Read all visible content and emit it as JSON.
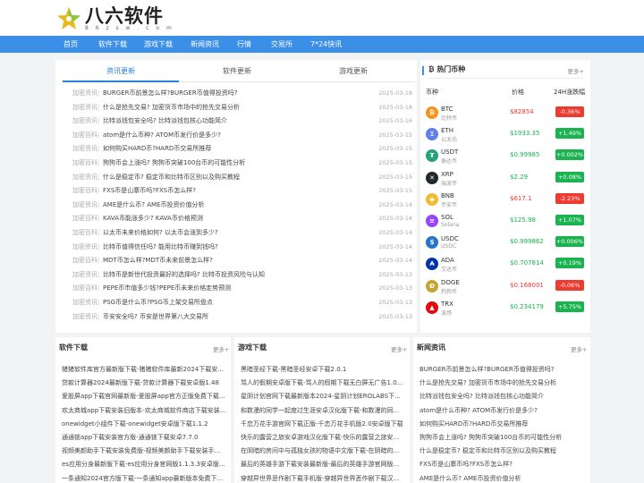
{
  "site": {
    "name": "八六软件",
    "domain": "8 6 z s w . c o m"
  },
  "nav": [
    "首页",
    "软件下载",
    "游戏下载",
    "新闻资讯",
    "行情",
    "交易所",
    "7*24快讯"
  ],
  "tabs": [
    "资讯更新",
    "软件更新",
    "游戏更新"
  ],
  "news": [
    {
      "cat": "加密资讯",
      "title": "BURGER币前景怎么样?BURGER币值得投资吗?",
      "date": "2025-03-18"
    },
    {
      "cat": "加密资讯",
      "title": "什么是抢先交易? 加密货币市场中的抢先交易分析",
      "date": "2025-03-18"
    },
    {
      "cat": "加密资讯",
      "title": "比特派钱包安全吗? 比特派钱包核心功能简介",
      "date": "2025-03-16"
    },
    {
      "cat": "加密百科",
      "title": "atom是什么币种? ATOM币发行价是多少?",
      "date": "2025-03-15"
    },
    {
      "cat": "加密资讯",
      "title": "如何购买HARD币?HARD币交易所推荐",
      "date": "2025-03-15"
    },
    {
      "cat": "加密百科",
      "title": "狗狗币会上涨吗? 狗狗币突破100台币的可能性分析",
      "date": "2025-03-15"
    },
    {
      "cat": "加密资讯",
      "title": "什么是稳定币? 稳定币和比特币区别以及购买教程",
      "date": "2025-03-15"
    },
    {
      "cat": "加密百科",
      "title": "FXS币是山寨币吗?FXS币怎么样?",
      "date": "2025-03-15"
    },
    {
      "cat": "加密资讯",
      "title": "AME是什么币? AME币投资价值分析",
      "date": "2025-03-14"
    },
    {
      "cat": "加密百科",
      "title": "KAVA币能涨多少? KAVA币价格预测",
      "date": "2025-03-14"
    },
    {
      "cat": "加密百科",
      "title": "以太币未来价格如何? 以太币会涨到多少?",
      "date": "2025-03-14"
    },
    {
      "cat": "加密资讯",
      "title": "比特币值得信任吗? 能用比特币赚到钱吗?",
      "date": "2025-03-14"
    },
    {
      "cat": "加密百科",
      "title": "MDT币怎么样?MDT币未来前景怎么样?",
      "date": "2025-03-14"
    },
    {
      "cat": "加密资讯",
      "title": "比特币是新世代投资最好的选择吗? 比特币投资风险与认知",
      "date": "2025-03-13"
    },
    {
      "cat": "加密百科",
      "title": "PEPE币市值多少钱?PEPE币未来价格走势预测",
      "date": "2025-03-13"
    },
    {
      "cat": "加密资讯",
      "title": "PSG币是什么币?PSG币上架交易所盘点",
      "date": "2025-03-13"
    },
    {
      "cat": "加密资讯",
      "title": "币安安全吗? 币安是世界第八大交易所",
      "date": "2025-03-13"
    }
  ],
  "coins": {
    "title": "热门币种",
    "more": "更多+",
    "headers": [
      "币种",
      "价格",
      "24H涨跌幅"
    ],
    "rows": [
      {
        "sym": "BTC",
        "cn": "比特币",
        "price": "$82854",
        "chg": "-0.36%",
        "icon_color": "#f7931a",
        "glyph": "₿"
      },
      {
        "sym": "ETH",
        "cn": "以太坊",
        "price": "$1933.35",
        "chg": "+1.49%",
        "icon_color": "#627eea",
        "glyph": "Ξ"
      },
      {
        "sym": "USDT",
        "cn": "泰达币",
        "price": "$0.99985",
        "chg": "+0.002%",
        "icon_color": "#26a17b",
        "glyph": "₮"
      },
      {
        "sym": "XRP",
        "cn": "瑞波币",
        "price": "$2.29",
        "chg": "+0.08%",
        "icon_color": "#23292f",
        "glyph": "✕"
      },
      {
        "sym": "BNB",
        "cn": "币安币",
        "price": "$617.1",
        "chg": "-2.23%",
        "icon_color": "#f3ba2f",
        "glyph": "◆"
      },
      {
        "sym": "SOL",
        "cn": "Solana",
        "price": "$125.98",
        "chg": "+1.07%",
        "icon_color": "#9945ff",
        "glyph": "≡"
      },
      {
        "sym": "USDC",
        "cn": "USDC",
        "price": "$0.999862",
        "chg": "+0.006%",
        "icon_color": "#2775ca",
        "glyph": "$"
      },
      {
        "sym": "ADA",
        "cn": "艾达币",
        "price": "$0.707814",
        "chg": "+0.19%",
        "icon_color": "#0033ad",
        "glyph": "₳"
      },
      {
        "sym": "DOGE",
        "cn": "狗狗币",
        "price": "$0.168001",
        "chg": "-0.06%",
        "icon_color": "#c2a633",
        "glyph": "Ð"
      },
      {
        "sym": "TRX",
        "cn": "波场",
        "price": "$0.234179",
        "chg": "+5.75%",
        "icon_color": "#e50915",
        "glyph": "▲"
      }
    ]
  },
  "colors": {
    "up": "#1ab34f",
    "down": "#ee3a2f",
    "brand": "#3b8fe6"
  },
  "sections": [
    {
      "title": "软件下载",
      "more": "更多+",
      "items": [
        "猪猪软件库官方最新版下载-猪猪软件库最新2024下载安...",
        "贷款计算器2024最新版下载-贷款计算器下载安卓版1.48",
        "爱股屏app下载官网最新版-爱股屏app官方正版免费下载...",
        "欢太商城app下载安装旧版本-欢太商城软件商店下载安装...",
        "onewidget小组件下载-onewidget安卓版下载1.1.2",
        "通通锁app下载安装官方版-通通锁下载安卓7.7.0",
        "视频美颜助手下载安装免费版-视频美颜助手下载安装手...",
        "es应用分身最新版下载-es应用分身官网版1.1.3.3安卓版...",
        "一条通知2024官方版下载-一条通知app最新版本免费下..."
      ]
    },
    {
      "title": "游戏下载",
      "more": "更多+",
      "items": [
        "黑暗圣经下载-黑暗圣经安卓下载2.0.1",
        "骂人的假期安卓版下载-骂人的假期下载无白屏无广告1.0...",
        "星阴计划官网下载最新版本2024-星阴计划EROLABS下...",
        "和数漫的同学一起度过生涯安卓汉化版下载-和数漫的同...",
        "千恋万花手游官网下载正版-千恋万花手机版2.0安卓版下载",
        "快乐的露营之旅安卓游戏汉化版下载-快乐的露营之旅安...",
        "在阴暗的房间中与孤独女孩的物语中文版下载-在阴暗的...",
        "最后的英雄手游下载安装最新版-最后的英雄手游官网版...",
        "穿越异世界恶作剧下载手机版-穿越异世界恶作剧下载汉..."
      ]
    },
    {
      "title": "新闻资讯",
      "more": "更多+",
      "items": [
        "BURGER币前景怎么样?BURGER币值得投资吗?",
        "什么是抢先交易? 加密货币市场中的抢先交易分析",
        "比特派钱包安全吗? 比特派钱包核心功能简介",
        "atom是什么币种? ATOM币发行价是多少?",
        "如何购买HARD币?HARD币交易所推荐",
        "狗狗币会上涨吗? 狗狗币突破100台币的可能性分析",
        "什么是稳定币? 稳定币和比特币区别以及购买教程",
        "FXS币是山寨币吗?FXS币怎么样?",
        "AME是什么币? AME币投资价值分析"
      ]
    }
  ]
}
